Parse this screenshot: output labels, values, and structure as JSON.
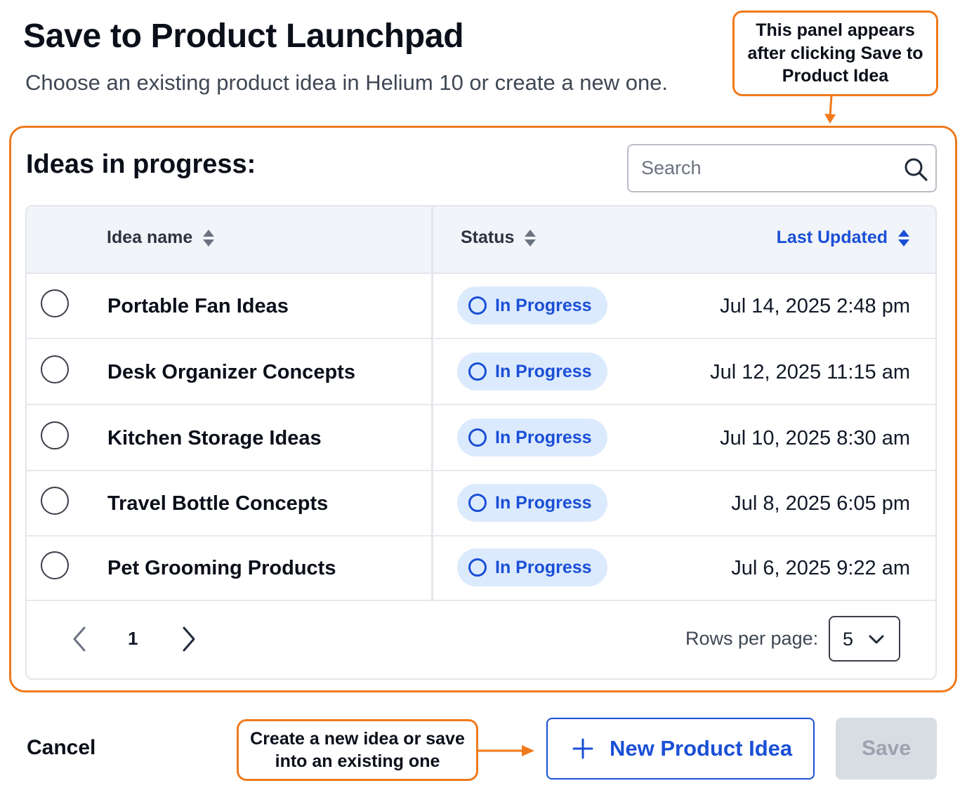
{
  "header": {
    "title": "Save to Product Launchpad",
    "subtitle": "Choose an existing product idea in Helium 10 or create a new one."
  },
  "callouts": {
    "top": "This panel appears after clicking Save to Product Idea",
    "bottom": "Create a new idea or save into an existing one"
  },
  "colors": {
    "accent_blue": "#1a4fd6",
    "callout_orange": "#f07a1c",
    "badge_bg": "#dceafd"
  },
  "panel": {
    "heading": "Ideas in progress:",
    "search": {
      "placeholder": "Search",
      "value": "",
      "icon": "search-icon"
    },
    "table": {
      "columns": {
        "name": "Idea name",
        "status": "Status",
        "updated": "Last Updated"
      },
      "active_sort_column": "updated",
      "rows": [
        {
          "name": "Portable Fan Ideas",
          "status": "In Progress",
          "updated": "Jul 14, 2025 2:48 pm"
        },
        {
          "name": "Desk Organizer Concepts",
          "status": "In Progress",
          "updated": "Jul 12, 2025 11:15 am"
        },
        {
          "name": "Kitchen Storage Ideas",
          "status": "In Progress",
          "updated": "Jul 10, 2025 8:30 am"
        },
        {
          "name": "Travel Bottle Concepts",
          "status": "In Progress",
          "updated": "Jul 8, 2025 6:05 pm"
        },
        {
          "name": "Pet Grooming Products",
          "status": "In Progress",
          "updated": "Jul 6, 2025 9:22 am"
        }
      ]
    },
    "pagination": {
      "page": "1",
      "rows_per_page_label": "Rows per page:",
      "rows_per_page_value": "5"
    }
  },
  "footer": {
    "cancel_label": "Cancel",
    "new_idea_label": "New Product Idea",
    "save_label": "Save"
  }
}
